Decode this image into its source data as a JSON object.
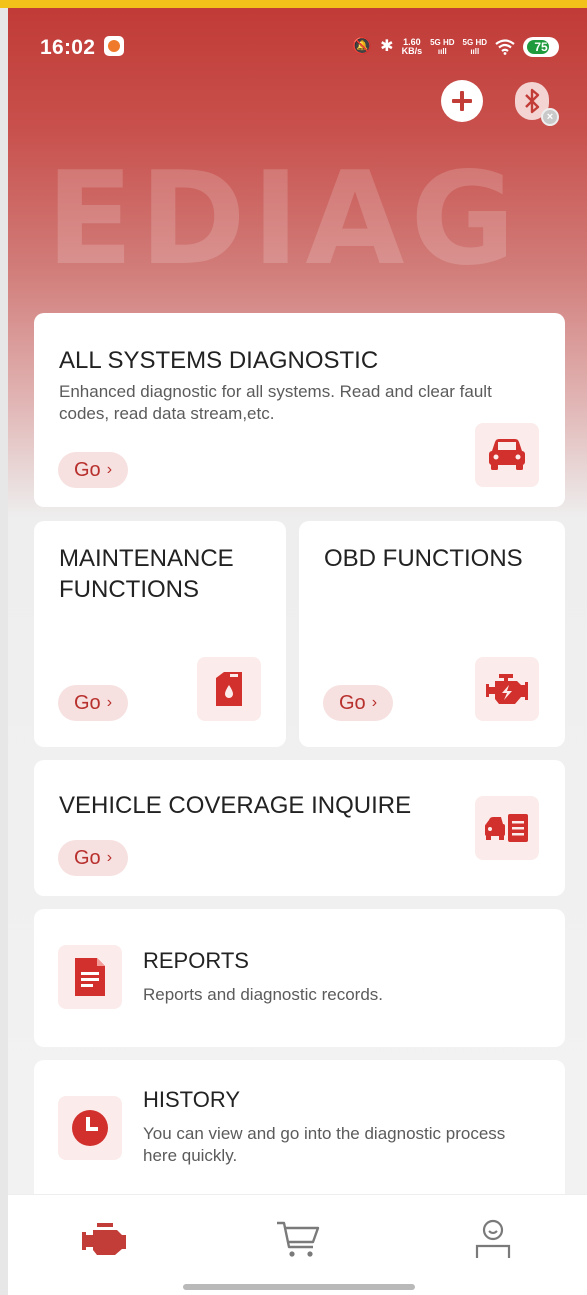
{
  "status_bar": {
    "time": "16:02",
    "speed_top": "1.60",
    "speed_bottom": "KB/s",
    "net1_top": "5G HD",
    "net1_bottom": "ııll",
    "net2_top": "5G HD",
    "net2_bottom": "ııll",
    "battery": "75"
  },
  "header": {
    "watermark": "EDIAG"
  },
  "cards": {
    "all_systems": {
      "title": "ALL SYSTEMS DIAGNOSTIC",
      "desc": "Enhanced diagnostic for all systems. Read and clear fault codes, read data stream,etc.",
      "go": "Go",
      "icon": "car-icon"
    },
    "maintenance": {
      "title": "MAINTENANCE FUNCTIONS",
      "go": "Go",
      "icon": "oil-can-icon"
    },
    "obd": {
      "title": "OBD FUNCTIONS",
      "go": "Go",
      "icon": "engine-icon"
    },
    "coverage": {
      "title": "VEHICLE COVERAGE INQUIRE",
      "go": "Go",
      "icon": "car-list-icon"
    },
    "reports": {
      "title": "REPORTS",
      "desc": "Reports and diagnostic records.",
      "icon": "document-icon"
    },
    "history": {
      "title": "HISTORY",
      "desc": "You can view and go into the diagnostic process here quickly.",
      "icon": "clock-icon"
    }
  },
  "nav": {
    "items": [
      "engine-icon",
      "cart-icon",
      "profile-icon"
    ]
  },
  "colors": {
    "brand": "#c13b37",
    "accent_red": "#d2302c",
    "tile_bg": "#fbeceb",
    "go_bg": "#f6e1e0"
  }
}
